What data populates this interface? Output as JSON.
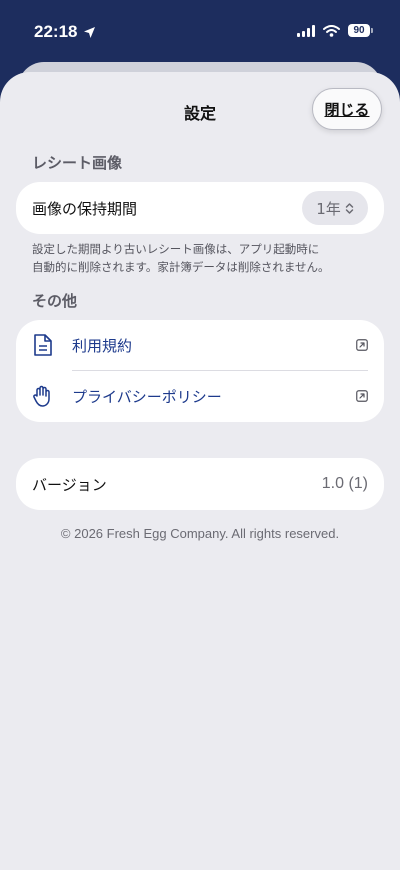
{
  "status_bar": {
    "time": "22:18",
    "battery": "90"
  },
  "header": {
    "title": "設定",
    "close_label": "閉じる"
  },
  "receipt_section": {
    "heading": "レシート画像",
    "retention_label": "画像の保持期間",
    "retention_value": "1年",
    "note_line1": "設定した期間より古いレシート画像は、アプリ起動時に",
    "note_line2": "自動的に削除されます。家計簿データは削除されません。"
  },
  "other_section": {
    "heading": "その他",
    "items": [
      {
        "label": "利用規約",
        "icon": "document-icon"
      },
      {
        "label": "プライバシーポリシー",
        "icon": "hand-icon"
      }
    ]
  },
  "version": {
    "label": "バージョン",
    "value": "1.0 (1)"
  },
  "footer": {
    "copyright": "© 2026 Fresh Egg Company. All rights reserved."
  },
  "colors": {
    "header_bg": "#1d2d5e",
    "sheet_bg": "#ebebf0",
    "link": "#1d3a8c"
  }
}
